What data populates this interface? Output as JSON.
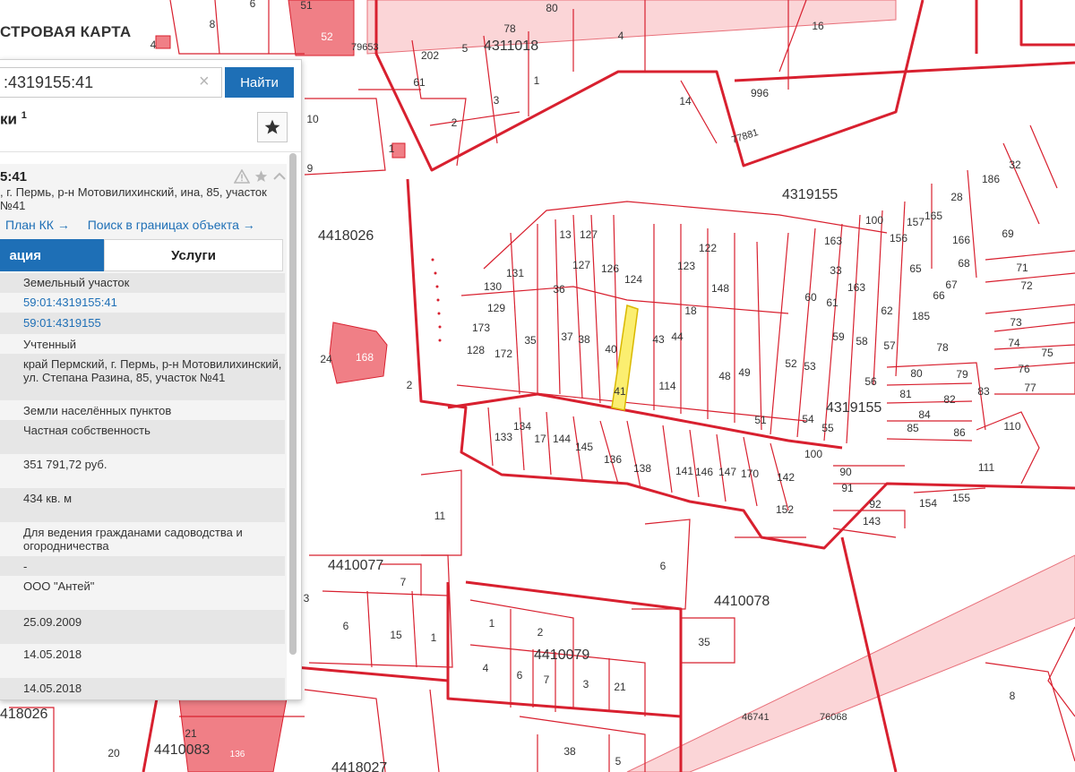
{
  "app": {
    "title": "СТРОВАЯ КАРТА"
  },
  "search": {
    "value": ":4319155:41",
    "clear_glyph": "×",
    "button": "Найти"
  },
  "results": {
    "label": "ки",
    "count": "1"
  },
  "card": {
    "id": "5:41",
    "address": ", г. Пермь, р-н Мотовилихинский, ина, 85, участок №41",
    "link_plan": "План КК →",
    "link_search": "Поиск в границах объекта →"
  },
  "tabs": {
    "info": "ация",
    "services": "Услуги"
  },
  "details": [
    "Земельный участок",
    "59:01:4319155:41",
    "59:01:4319155",
    "Учтенный",
    "край Пермский, г. Пермь, р-н Мотовилихинский, ул. Степана Разина, 85, участок №41",
    "Земли населённых пунктов",
    "Частная собственность",
    "351 791,72 руб.",
    "434 кв. м",
    "Для ведения гражданами садоводства и огородничества",
    "-",
    "ООО \"Антей\"",
    "25.09.2009",
    "14.05.2018",
    "14.05.2018"
  ],
  "map": {
    "colors": {
      "boundary": "#d8202f",
      "fill_pink": "#f07f86",
      "fill_pale": "#fbd5d7",
      "highlight_fill": "#fbee70",
      "highlight_stroke": "#d9b800"
    },
    "quarter_labels": [
      "4311018",
      "4319155",
      "4418026",
      "4319155",
      "4410077",
      "4410078",
      "4410079",
      "4410083",
      "4418027",
      "418026",
      "46741",
      "76068",
      "77881",
      "79653"
    ],
    "parcel_labels": [
      "8",
      "6",
      "51",
      "52",
      "4",
      "78",
      "80",
      "16",
      "202",
      "5",
      "4",
      "61",
      "3",
      "1",
      "996",
      "2",
      "14",
      "10",
      "1",
      "9",
      "131",
      "13",
      "127",
      "130",
      "36",
      "127",
      "126",
      "124",
      "122",
      "129",
      "123",
      "148",
      "173",
      "37",
      "38",
      "40",
      "43",
      "44",
      "18",
      "128",
      "172",
      "35",
      "41",
      "114",
      "48",
      "49",
      "24",
      "168",
      "2",
      "133",
      "134",
      "17",
      "144",
      "145",
      "136",
      "138",
      "141",
      "146",
      "147",
      "170",
      "142",
      "152",
      "11",
      "7",
      "6",
      "1",
      "2",
      "15",
      "1",
      "3",
      "6",
      "4",
      "6",
      "7",
      "3",
      "21",
      "35",
      "20",
      "21",
      "136",
      "38",
      "5",
      "8",
      "100",
      "156",
      "157",
      "165",
      "28",
      "166",
      "69",
      "186",
      "32",
      "163",
      "33",
      "60",
      "61",
      "163",
      "62",
      "185",
      "52",
      "53",
      "59",
      "58",
      "57",
      "78",
      "73",
      "74",
      "75",
      "76",
      "77",
      "71",
      "72",
      "80",
      "79",
      "81",
      "82",
      "83",
      "84",
      "85",
      "86",
      "110",
      "111",
      "90",
      "91",
      "92",
      "143",
      "154",
      "155",
      "56",
      "51",
      "54",
      "55",
      "100",
      "65",
      "66",
      "67",
      "68"
    ]
  }
}
